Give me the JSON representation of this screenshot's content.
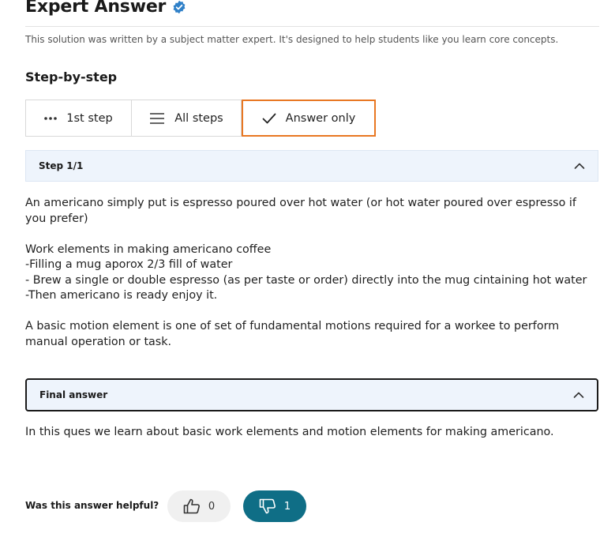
{
  "header": {
    "title": "Expert Answer",
    "subtitle": "This solution was written by a subject matter expert. It's designed to help students like you learn core concepts."
  },
  "section_title": "Step-by-step",
  "tabs": [
    {
      "label": "1st step",
      "icon": "dots-icon"
    },
    {
      "label": "All steps",
      "icon": "list-icon"
    },
    {
      "label": "Answer only",
      "icon": "check-icon",
      "selected": true
    }
  ],
  "step_panel": {
    "label": "Step 1/1",
    "paragraphs": [
      "An americano simply put is espresso poured over hot water (or hot water poured over espresso if you prefer)",
      "Work elements in making americano coffee",
      "-Filling a mug aporox 2/3 fill of water",
      "- Brew a single or double espresso (as per taste or order) directly into the mug cintaining hot water",
      "-Then americano is ready enjoy it.",
      "A  basic motion element is one of set of fundamental motions required for a workee to perform manual operation or task."
    ]
  },
  "final_panel": {
    "label": "Final answer",
    "text": "In this ques we learn about basic work elements and motion elements for making americano."
  },
  "feedback": {
    "question": "Was this answer helpful?",
    "up_count": "0",
    "down_count": "1"
  },
  "colors": {
    "accent_orange": "#e87722",
    "panel_bg": "#eef4fc",
    "downvote_bg": "#0f6e86",
    "verified_blue": "#2f80c8"
  }
}
